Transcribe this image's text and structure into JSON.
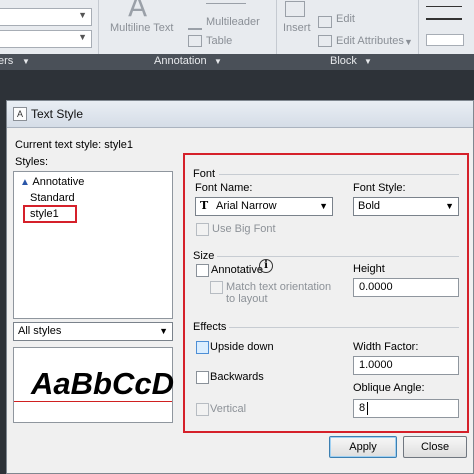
{
  "ribbon": {
    "multiline_text": "Multiline Text",
    "multileader": "Multileader",
    "table": "Table",
    "insert": "Insert",
    "edit": "Edit",
    "edit_attributes": "Edit Attributes",
    "panels": {
      "annotation": "Annotation",
      "block": "Block",
      "left_tail": "ers"
    }
  },
  "dialog": {
    "title": "Text Style",
    "current_style_label": "Current text style:",
    "current_style_value": "style1",
    "styles_label": "Styles:",
    "styles": [
      "Annotative",
      "Standard",
      "style1"
    ],
    "filter": "All styles",
    "preview_text": "AaBbCcD",
    "font": {
      "section": "Font",
      "font_name_label": "Font Name:",
      "font_name_value": "Arial Narrow",
      "font_style_label": "Font Style:",
      "font_style_value": "Bold",
      "use_big_font": "Use Big Font"
    },
    "size": {
      "section": "Size",
      "annotative": "Annotative",
      "match_orientation": "Match text orientation to layout",
      "height_label": "Height",
      "height_value": "0.0000"
    },
    "effects": {
      "section": "Effects",
      "upside_down": "Upside down",
      "backwards": "Backwards",
      "vertical": "Vertical",
      "width_factor_label": "Width Factor:",
      "width_factor_value": "1.0000",
      "oblique_angle_label": "Oblique Angle:",
      "oblique_angle_value": "8"
    },
    "apply": "Apply",
    "close": "Close"
  },
  "colors": {
    "highlight": "#d5202a",
    "ribbon_bg": "#e8ebef",
    "panel_bar": "#4a5058"
  }
}
